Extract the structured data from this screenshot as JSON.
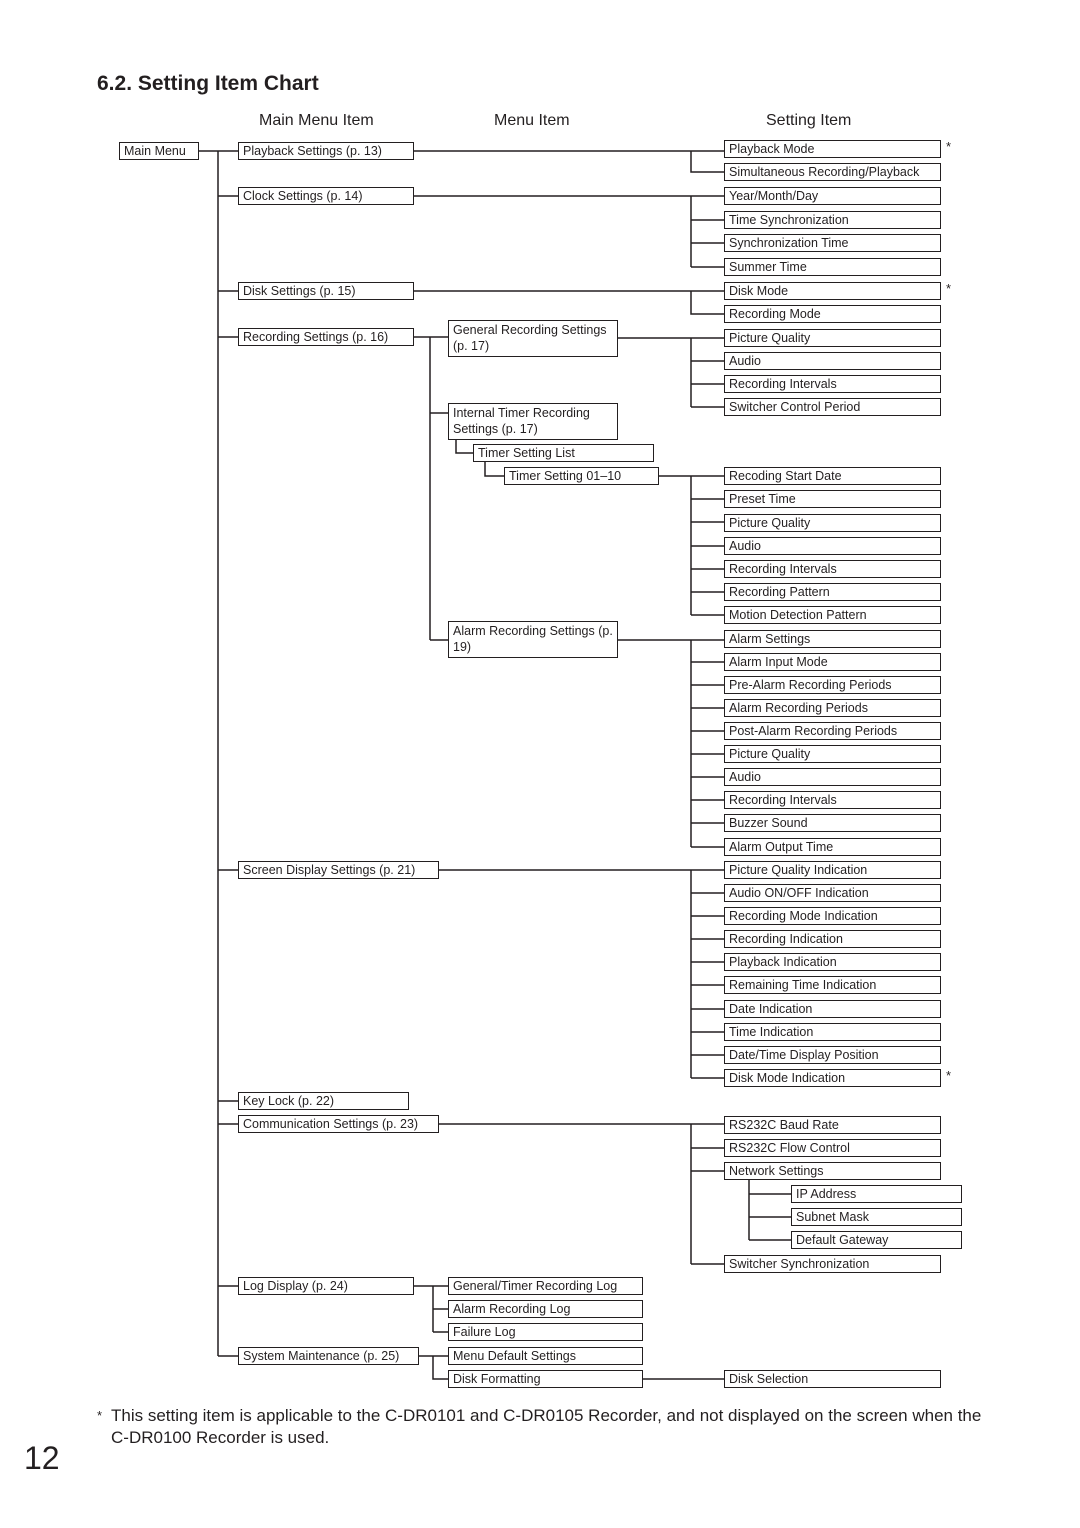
{
  "page": {
    "title": "6.2. Setting Item Chart",
    "column_headers": [
      "Main Menu Item",
      "Menu Item",
      "Setting Item"
    ],
    "root": "Main Menu",
    "footnote_mark": "*",
    "footnote": "This setting item is applicable to the C-DR0101 and C-DR0105 Recorder, and not displayed on the screen when the C-DR0100 Recorder is used.",
    "page_number": "12"
  },
  "main_menu_items": [
    "Playback Settings (p. 13)",
    "Clock Settings (p. 14)",
    "Disk Settings (p. 15)",
    "Recording Settings (p. 16)",
    "Screen Display Settings (p. 21)",
    "Key Lock (p. 22)",
    "Communication Settings (p. 23)",
    "Log Display (p. 24)",
    "System Maintenance (p. 25)"
  ],
  "menu_items": [
    "General Recording Settings (p. 17)",
    "Internal Timer Recording Settings (p. 17)",
    "Timer Setting List",
    "Timer Setting 01–10",
    "Alarm Recording Settings (p. 19)",
    "General/Timer Recording Log",
    "Alarm Recording Log",
    "Failure Log",
    "Menu Default Settings",
    "Disk Formatting"
  ],
  "setting_items": [
    {
      "label": "Playback Mode",
      "star": "*"
    },
    {
      "label": "Simultaneous Recording/Playback"
    },
    {
      "label": "Year/Month/Day"
    },
    {
      "label": "Time Synchronization"
    },
    {
      "label": "Synchronization Time"
    },
    {
      "label": "Summer Time"
    },
    {
      "label": "Disk Mode",
      "star": "*"
    },
    {
      "label": "Recording Mode"
    },
    {
      "label": "Picture Quality"
    },
    {
      "label": "Audio"
    },
    {
      "label": "Recording Intervals"
    },
    {
      "label": "Switcher Control Period"
    },
    {
      "label": "Recoding Start Date"
    },
    {
      "label": "Preset Time"
    },
    {
      "label": "Picture Quality"
    },
    {
      "label": "Audio"
    },
    {
      "label": "Recording Intervals"
    },
    {
      "label": "Recording Pattern"
    },
    {
      "label": "Motion Detection Pattern"
    },
    {
      "label": "Alarm Settings"
    },
    {
      "label": "Alarm Input Mode"
    },
    {
      "label": "Pre-Alarm Recording Periods"
    },
    {
      "label": "Alarm Recording Periods"
    },
    {
      "label": "Post-Alarm Recording Periods"
    },
    {
      "label": "Picture Quality"
    },
    {
      "label": "Audio"
    },
    {
      "label": "Recording Intervals"
    },
    {
      "label": "Buzzer Sound"
    },
    {
      "label": "Alarm Output Time"
    },
    {
      "label": "Picture Quality Indication"
    },
    {
      "label": "Audio ON/OFF Indication"
    },
    {
      "label": "Recording Mode Indication"
    },
    {
      "label": "Recording Indication"
    },
    {
      "label": "Playback Indication"
    },
    {
      "label": "Remaining Time Indication"
    },
    {
      "label": "Date Indication"
    },
    {
      "label": "Time Indication"
    },
    {
      "label": "Date/Time Display Position"
    },
    {
      "label": "Disk Mode Indication",
      "star": "*"
    },
    {
      "label": "RS232C Baud Rate"
    },
    {
      "label": "RS232C Flow Control"
    },
    {
      "label": "Network Settings"
    },
    {
      "label": "Switcher Synchronization"
    },
    {
      "label": "Disk Selection"
    }
  ],
  "network_sub_items": [
    "IP Address",
    "Subnet Mask",
    "Default Gateway"
  ]
}
